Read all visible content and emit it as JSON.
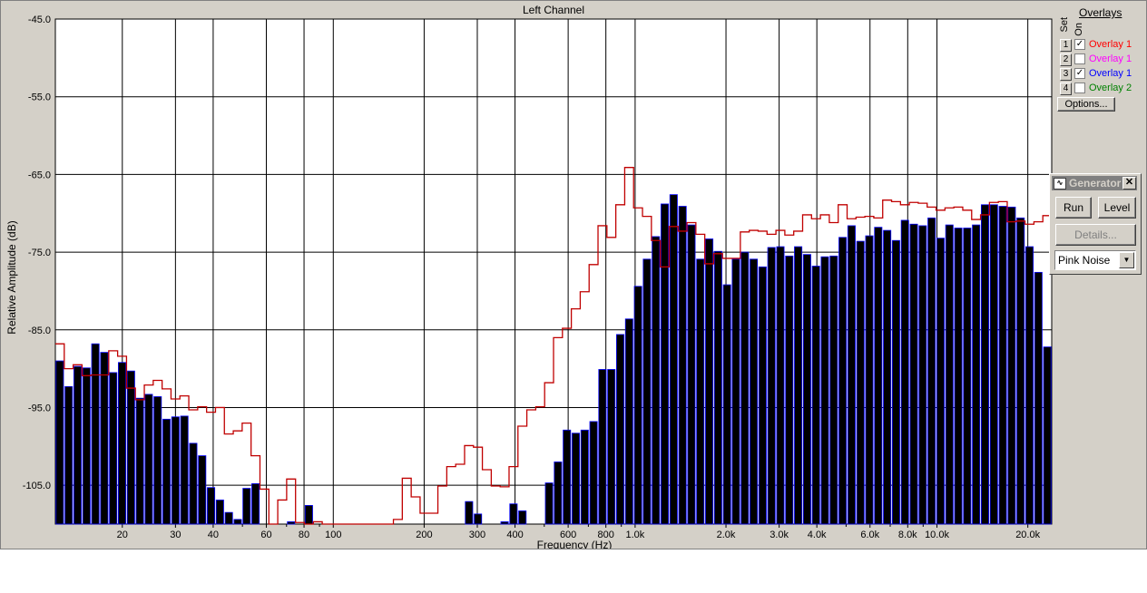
{
  "chart_data": {
    "type": "bar",
    "title": "Left Channel",
    "xlabel": "Frequency (Hz)",
    "ylabel": "Relative Amplitude (dB)",
    "xscale": "log",
    "xlim": [
      12,
      24000
    ],
    "ylim": [
      -110,
      -45
    ],
    "grid": true,
    "y_ticks": [
      "-45.0",
      "-55.0",
      "-65.0",
      "-75.0",
      "-85.0",
      "-95.0",
      "-105.0"
    ],
    "y_tick_values": [
      -45,
      -55,
      -65,
      -75,
      -85,
      -95,
      -105
    ],
    "x_ticks": [
      "20",
      "30",
      "40",
      "60",
      "80",
      "100",
      "200",
      "300",
      "400",
      "600",
      "800",
      "1.0k",
      "2.0k",
      "3.0k",
      "4.0k",
      "6.0k",
      "8.0k",
      "10.0k",
      "20.0k"
    ],
    "x_tick_values": [
      20,
      30,
      40,
      60,
      80,
      100,
      200,
      300,
      400,
      600,
      800,
      1000,
      2000,
      3000,
      4000,
      6000,
      8000,
      10000,
      20000
    ],
    "series": [
      {
        "name": "Overlay 1",
        "style": "filled bars",
        "color": "#000000",
        "edge_color": "#0000ff",
        "values": [
          -89,
          -92.3,
          -89.7,
          -89.9,
          -86.8,
          -87.9,
          -90.5,
          -89.2,
          -90.3,
          -93.8,
          -93.3,
          -93.6,
          -96.5,
          -96.2,
          -96.1,
          -99.6,
          -101.2,
          -105.3,
          -106.9,
          -108.5,
          -109.4,
          -105.4,
          -104.8,
          -110,
          -110,
          -110,
          -109.7,
          -110,
          -107.6,
          -110,
          -110,
          -110,
          -110,
          -110,
          -110,
          -110,
          -110,
          -110,
          -110,
          -110,
          -110,
          -110,
          -110,
          -110,
          -110,
          -110,
          -107.1,
          -108.7,
          -110,
          -110,
          -109.7,
          -107.4,
          -108.3,
          -110,
          -110,
          -104.7,
          -102,
          -97.9,
          -98.3,
          -97.9,
          -96.8,
          -90.1,
          -90.1,
          -85.6,
          -83.6,
          -79.4,
          -75.9,
          -73,
          -68.8,
          -67.6,
          -69.1,
          -71.5,
          -75.9,
          -73.3,
          -74.9,
          -79.2,
          -75.9,
          -75,
          -75.9,
          -76.9,
          -74.4,
          -74.3,
          -75.5,
          -74.3,
          -75.3,
          -76.8,
          -75.6,
          -75.5,
          -73.1,
          -71.6,
          -73.6,
          -72.9,
          -71.8,
          -72.2,
          -73.5,
          -70.9,
          -71.4,
          -71.6,
          -70.6,
          -73.2,
          -71.5,
          -71.9,
          -71.9,
          -71.5,
          -68.9,
          -68.9,
          -69.1,
          -69.2,
          -70.6,
          -74.3,
          -77.6,
          -87.2
        ]
      },
      {
        "name": "Overlay 1",
        "style": "step line",
        "color": "#c00000",
        "values": [
          -86.8,
          -90,
          -89.5,
          -90.9,
          -90.8,
          -90.8,
          -87.7,
          -88.4,
          -92.5,
          -94,
          -92.1,
          -91.5,
          -92.6,
          -93.9,
          -93.5,
          -95.3,
          -94.9,
          -95.6,
          -95,
          -98.4,
          -98,
          -97,
          -101.2,
          -105.5,
          -110,
          -106.9,
          -104.2,
          -109.8,
          -110,
          -109.7,
          -110,
          -110,
          -110,
          -110,
          -110,
          -110,
          -110,
          -110,
          -109.4,
          -104.1,
          -106.5,
          -108.6,
          -108.6,
          -105.1,
          -102.6,
          -102.3,
          -99.9,
          -100.1,
          -103,
          -105.1,
          -105.2,
          -102.6,
          -97.4,
          -95.3,
          -94.9,
          -91.8,
          -86,
          -84.8,
          -82.3,
          -80.1,
          -76.6,
          -71.6,
          -73.1,
          -68.9,
          -64.1,
          -69.3,
          -70.4,
          -73.5,
          -76.9,
          -71.7,
          -72.3,
          -71.2,
          -72.7,
          -76.5,
          -75.2,
          -75.8,
          -75.8,
          -72.4,
          -72.2,
          -72.3,
          -72.7,
          -72.2,
          -72.8,
          -72.3,
          -70.2,
          -70.7,
          -70.2,
          -71.2,
          -68.9,
          -70.7,
          -70.5,
          -70.4,
          -70.6,
          -68.3,
          -68.5,
          -68.9,
          -68.6,
          -68.7,
          -69.2,
          -69.6,
          -69.3,
          -69.2,
          -69.6,
          -70.8,
          -70.2,
          -68.6,
          -68.5,
          -71.1,
          -71,
          -71.4,
          -71.1,
          -70.3,
          -70.9,
          -93.4
        ]
      }
    ]
  },
  "overlays": {
    "title": "Overlays",
    "col_set": "Set",
    "col_on": "On",
    "rows": [
      {
        "set": "1",
        "checked": true,
        "label": "Overlay 1",
        "color": "#ff0000"
      },
      {
        "set": "2",
        "checked": false,
        "label": "Overlay 1",
        "color": "#ff00ff"
      },
      {
        "set": "3",
        "checked": true,
        "label": "Overlay 1",
        "color": "#0000ff"
      },
      {
        "set": "4",
        "checked": false,
        "label": "Overlay 2",
        "color": "#008000"
      }
    ],
    "options_label": "Options..."
  },
  "generator": {
    "title": "Generator",
    "run_label": "Run",
    "level_label": "Level",
    "details_label": "Details...",
    "signal_selected": "Pink Noise",
    "close_symbol": "✕"
  }
}
